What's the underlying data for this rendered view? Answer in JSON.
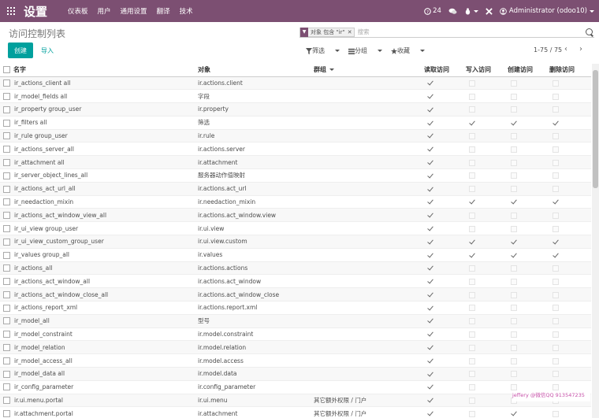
{
  "topbar": {
    "app_title": "设置",
    "menu": [
      "仪表板",
      "用户",
      "通用设置",
      "翻译",
      "技术"
    ],
    "badge_count": "24",
    "user": "Administrator (odoo10)"
  },
  "breadcrumb": "访问控制列表",
  "search": {
    "facet_text": "对象 包含 \"ir\"",
    "facet_close": "✕",
    "placeholder": "搜索"
  },
  "buttons": {
    "create": "创建",
    "import": "导入"
  },
  "filters": {
    "filter": "筛选",
    "group": "分组",
    "favorites": "收藏"
  },
  "pager": {
    "text": "1-75 / 75",
    "prev": "‹",
    "next": "›"
  },
  "columns": [
    "名字",
    "对象",
    "群组",
    "读取访问",
    "写入访问",
    "创建访问",
    "删除访问"
  ],
  "rows": [
    {
      "name": "ir_actions_client all",
      "model": "ir.actions.client",
      "group": "",
      "read": true,
      "write": false,
      "create": false,
      "unlink": false
    },
    {
      "name": "ir_model_fields all",
      "model": "字段",
      "group": "",
      "read": true,
      "write": false,
      "create": false,
      "unlink": false
    },
    {
      "name": "ir_property group_user",
      "model": "ir.property",
      "group": "",
      "read": true,
      "write": false,
      "create": false,
      "unlink": false
    },
    {
      "name": "ir_filters all",
      "model": "筛选",
      "group": "",
      "read": true,
      "write": true,
      "create": true,
      "unlink": true
    },
    {
      "name": "ir_rule group_user",
      "model": "ir.rule",
      "group": "",
      "read": true,
      "write": false,
      "create": false,
      "unlink": false
    },
    {
      "name": "ir_actions_server_all",
      "model": "ir.actions.server",
      "group": "",
      "read": true,
      "write": false,
      "create": false,
      "unlink": false
    },
    {
      "name": "ir_attachment all",
      "model": "ir.attachment",
      "group": "",
      "read": true,
      "write": false,
      "create": false,
      "unlink": false
    },
    {
      "name": "ir_server_object_lines_all",
      "model": "服务器动作值映射",
      "group": "",
      "read": true,
      "write": false,
      "create": false,
      "unlink": false
    },
    {
      "name": "ir_actions_act_url_all",
      "model": "ir.actions.act_url",
      "group": "",
      "read": true,
      "write": false,
      "create": false,
      "unlink": false
    },
    {
      "name": "ir_needaction_mixin",
      "model": "ir.needaction_mixin",
      "group": "",
      "read": true,
      "write": true,
      "create": true,
      "unlink": true
    },
    {
      "name": "ir_actions_act_window_view_all",
      "model": "ir.actions.act_window.view",
      "group": "",
      "read": true,
      "write": false,
      "create": false,
      "unlink": false
    },
    {
      "name": "ir_ui_view group_user",
      "model": "ir.ui.view",
      "group": "",
      "read": true,
      "write": false,
      "create": false,
      "unlink": false
    },
    {
      "name": "ir_ui_view_custom_group_user",
      "model": "ir.ui.view.custom",
      "group": "",
      "read": true,
      "write": true,
      "create": true,
      "unlink": true
    },
    {
      "name": "ir_values group_all",
      "model": "ir.values",
      "group": "",
      "read": true,
      "write": true,
      "create": true,
      "unlink": true
    },
    {
      "name": "ir_actions_all",
      "model": "ir.actions.actions",
      "group": "",
      "read": true,
      "write": false,
      "create": false,
      "unlink": false
    },
    {
      "name": "ir_actions_act_window_all",
      "model": "ir.actions.act_window",
      "group": "",
      "read": true,
      "write": false,
      "create": false,
      "unlink": false
    },
    {
      "name": "ir_actions_act_window_close_all",
      "model": "ir.actions.act_window_close",
      "group": "",
      "read": true,
      "write": false,
      "create": false,
      "unlink": false
    },
    {
      "name": "ir_actions_report_xml",
      "model": "ir.actions.report.xml",
      "group": "",
      "read": true,
      "write": false,
      "create": false,
      "unlink": false
    },
    {
      "name": "ir_model_all",
      "model": "型号",
      "group": "",
      "read": true,
      "write": false,
      "create": false,
      "unlink": false
    },
    {
      "name": "ir_model_constraint",
      "model": "ir.model.constraint",
      "group": "",
      "read": true,
      "write": false,
      "create": false,
      "unlink": false
    },
    {
      "name": "ir_model_relation",
      "model": "ir.model.relation",
      "group": "",
      "read": true,
      "write": false,
      "create": false,
      "unlink": false
    },
    {
      "name": "ir_model_access_all",
      "model": "ir.model.access",
      "group": "",
      "read": true,
      "write": false,
      "create": false,
      "unlink": false
    },
    {
      "name": "ir_model_data all",
      "model": "ir.model.data",
      "group": "",
      "read": true,
      "write": false,
      "create": false,
      "unlink": false
    },
    {
      "name": "ir_config_parameter",
      "model": "ir.config_parameter",
      "group": "",
      "read": true,
      "write": false,
      "create": false,
      "unlink": false
    },
    {
      "name": "ir.ui.menu.portal",
      "model": "ir.ui.menu",
      "group": "其它额外权限 / 门户",
      "read": true,
      "write": false,
      "create": false,
      "unlink": false
    },
    {
      "name": "ir.attachment.portal",
      "model": "ir.attachment",
      "group": "其它额外权限 / 门户",
      "read": true,
      "write": false,
      "create": true,
      "unlink": false
    }
  ],
  "watermark": "jeffery @微信QQ 913547235",
  "colors": {
    "topbar": "#7c4f72",
    "accent": "#00a09d"
  }
}
